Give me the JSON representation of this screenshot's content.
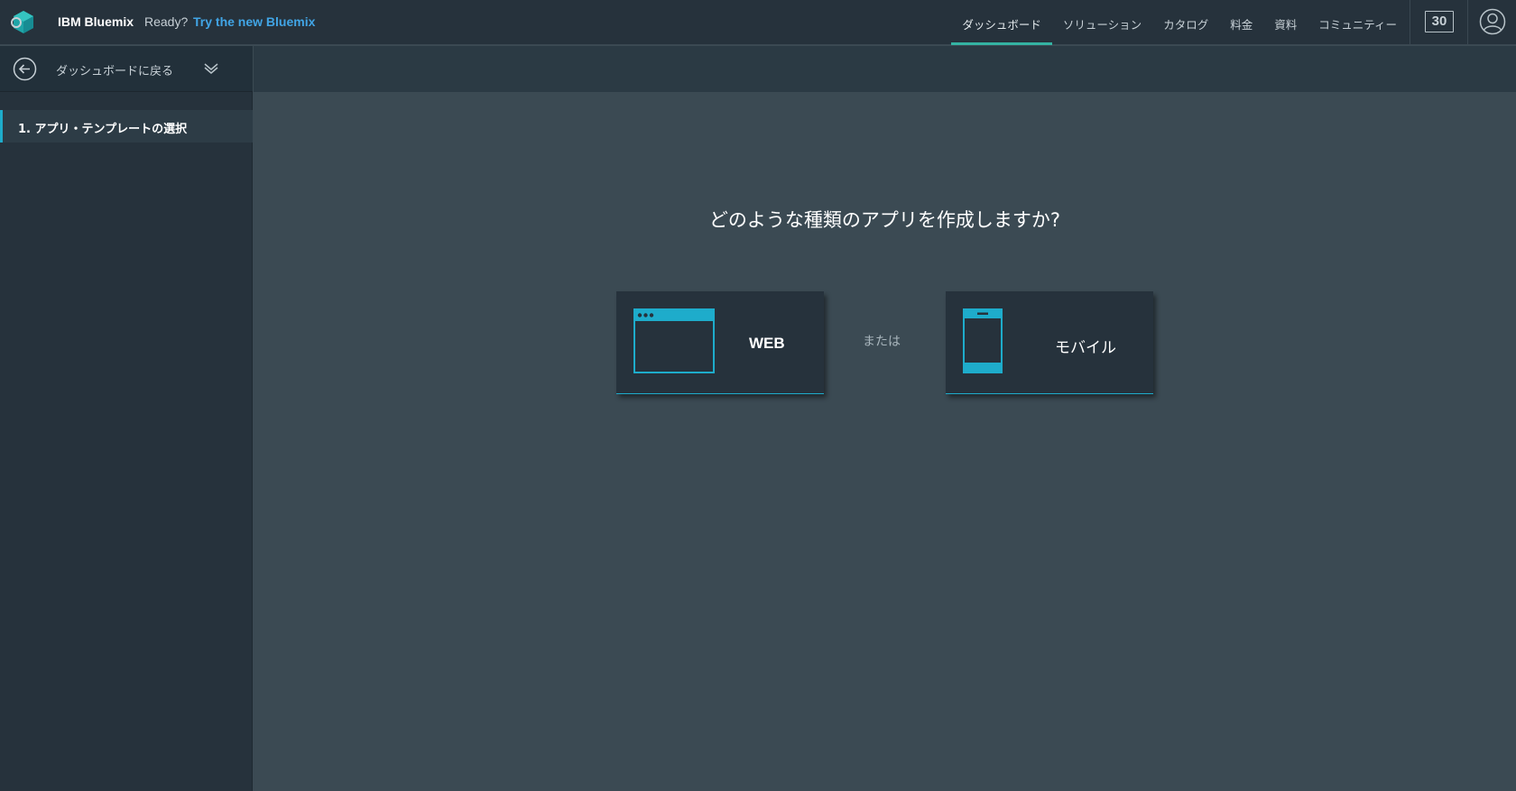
{
  "header": {
    "brand_bold": "IBM Bluemix",
    "ready_text": "Ready?",
    "try_link": "Try the new Bluemix",
    "nav": [
      {
        "label": "ダッシュボード",
        "active": true
      },
      {
        "label": "ソリューション",
        "active": false
      },
      {
        "label": "カタログ",
        "active": false
      },
      {
        "label": "料金",
        "active": false
      },
      {
        "label": "資料",
        "active": false
      },
      {
        "label": "コミュニティー",
        "active": false
      }
    ],
    "trial_days": "30",
    "icons": {
      "logo": "bluemix-logo-icon",
      "account": "user-account-icon"
    }
  },
  "sidebar": {
    "back_label": "ダッシュボードに戻る",
    "steps": [
      {
        "label": "1. アプリ・テンプレートの選択",
        "active": true
      }
    ],
    "icons": {
      "back": "back-arrow-icon",
      "expand": "chevron-down-icon"
    }
  },
  "main": {
    "question": "どのような種類のアプリを作成しますか?",
    "or_label": "または",
    "options": {
      "web": {
        "label": "WEB",
        "icon": "browser-window-icon"
      },
      "mobile": {
        "label": "モバイル",
        "icon": "mobile-phone-icon"
      }
    }
  },
  "colors": {
    "accent": "#1eaccb",
    "nav_active_underline": "#34b3a3",
    "link": "#41a5e6",
    "header_bg": "#26323c",
    "main_bg": "#3b4a53"
  }
}
